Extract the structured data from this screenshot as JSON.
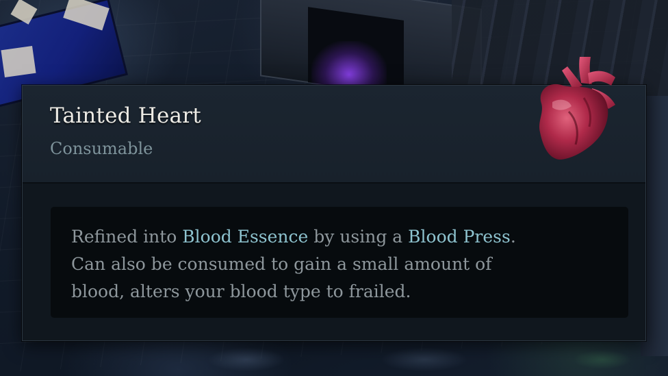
{
  "tooltip": {
    "name": "Tainted Heart",
    "type": "Consumable",
    "icon": "heart-icon",
    "description": {
      "line1": {
        "prefix": "Refined into ",
        "keyword1": "Blood Essence",
        "middle": " by using a ",
        "keyword2": "Blood Press",
        "suffix": "."
      },
      "line2": "Can also be consumed to gain a small amount of",
      "line3": "blood, alters your blood type to frailed."
    }
  },
  "colors": {
    "name": "#eeece6",
    "type": "#7e939b",
    "body_text": "#8e979c",
    "keyword": "#8ec3cf",
    "header_bg": "#1b2530",
    "panel_bg": "#10171e",
    "desc_bg": "#070b0e",
    "heart": "#b02a4a"
  }
}
